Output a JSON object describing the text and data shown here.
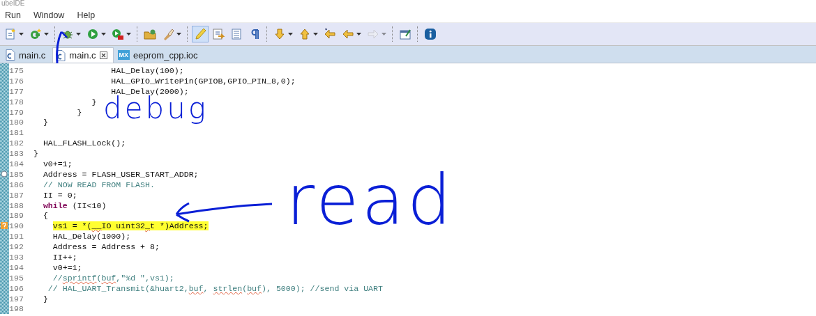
{
  "window": {
    "title": "ubeIDE"
  },
  "menu": [
    "Run",
    "Window",
    "Help"
  ],
  "toolbar": [
    {
      "kind": "new-c-file",
      "dropdown": true,
      "selected": false,
      "disabled": false
    },
    {
      "kind": "new-class",
      "dropdown": true,
      "selected": false,
      "disabled": false
    },
    {
      "kind": "separator"
    },
    {
      "kind": "debug",
      "dropdown": true,
      "selected": false,
      "disabled": false
    },
    {
      "kind": "run",
      "dropdown": true,
      "selected": false,
      "disabled": false
    },
    {
      "kind": "external-tool",
      "dropdown": true,
      "selected": false,
      "disabled": false
    },
    {
      "kind": "separator"
    },
    {
      "kind": "open-folder",
      "dropdown": false,
      "selected": false,
      "disabled": false
    },
    {
      "kind": "brush",
      "dropdown": true,
      "selected": false,
      "disabled": false
    },
    {
      "kind": "separator"
    },
    {
      "kind": "highlight",
      "dropdown": false,
      "selected": true,
      "disabled": false
    },
    {
      "kind": "toggle-word",
      "dropdown": false,
      "selected": false,
      "disabled": false
    },
    {
      "kind": "block",
      "dropdown": false,
      "selected": false,
      "disabled": false
    },
    {
      "kind": "pilcrow",
      "dropdown": false,
      "selected": false,
      "disabled": false
    },
    {
      "kind": "separator"
    },
    {
      "kind": "next-annotation",
      "dropdown": true,
      "selected": false,
      "disabled": false
    },
    {
      "kind": "prev-annotation",
      "dropdown": true,
      "selected": false,
      "disabled": false
    },
    {
      "kind": "last-edit",
      "dropdown": false,
      "selected": false,
      "disabled": false
    },
    {
      "kind": "back",
      "dropdown": true,
      "selected": false,
      "disabled": false
    },
    {
      "kind": "forward",
      "dropdown": true,
      "selected": false,
      "disabled": true
    },
    {
      "kind": "separator"
    },
    {
      "kind": "window",
      "dropdown": false,
      "selected": false,
      "disabled": false
    },
    {
      "kind": "separator"
    },
    {
      "kind": "info",
      "dropdown": false,
      "selected": false,
      "disabled": false
    }
  ],
  "tabs": [
    {
      "label": "main.c",
      "selected": false,
      "closable": false
    },
    {
      "label": "main.c",
      "selected": true,
      "closable": true
    },
    {
      "label": "eeprom_cpp.ioc",
      "badge": "MX",
      "selected": false,
      "closable": false
    }
  ],
  "editor": {
    "lines": [
      {
        "number": "175",
        "highlighted": false,
        "segments": [
          {
            "text": "                HAL_Delay(100);",
            "kind": "plain"
          }
        ]
      },
      {
        "number": "176",
        "highlighted": false,
        "segments": [
          {
            "text": "                HAL_GPIO_WritePin(GPIOB,GPIO_PIN_8,0);",
            "kind": "plain"
          }
        ]
      },
      {
        "number": "177",
        "highlighted": false,
        "segments": [
          {
            "text": "                HAL_Delay(2000);",
            "kind": "plain"
          }
        ]
      },
      {
        "number": "178",
        "highlighted": false,
        "segments": [
          {
            "text": "            }",
            "kind": "plain"
          }
        ]
      },
      {
        "number": "179",
        "highlighted": false,
        "segments": [
          {
            "text": "         }",
            "kind": "plain"
          }
        ]
      },
      {
        "number": "180",
        "highlighted": false,
        "segments": [
          {
            "text": "  }",
            "kind": "plain"
          }
        ]
      },
      {
        "number": "181"
      },
      {
        "number": "182",
        "highlighted": false,
        "segments": [
          {
            "text": "  HAL_FLASH_Lock();",
            "kind": "plain"
          }
        ]
      },
      {
        "number": "183",
        "highlighted": false,
        "segments": [
          {
            "text": "}",
            "kind": "plain"
          }
        ]
      },
      {
        "number": "184",
        "highlighted": false,
        "segments": [
          {
            "text": "  v0+=1;",
            "kind": "plain"
          }
        ]
      },
      {
        "number": "185",
        "highlighted": false,
        "marker": {
          "kind": "circle"
        },
        "segments": [
          {
            "text": "  Address = FLASH_USER_START_ADDR;",
            "kind": "plain"
          }
        ]
      },
      {
        "number": "186",
        "highlighted": false,
        "segments": [
          {
            "text": "  // NOW READ FROM FLASH.",
            "kind": "comment"
          }
        ]
      },
      {
        "number": "187",
        "highlighted": false,
        "segments": [
          {
            "text": "  II = 0;",
            "kind": "plain"
          }
        ]
      },
      {
        "number": "188",
        "highlighted": false,
        "segments": [
          {
            "text": "  while",
            "kind": "keyword"
          },
          {
            "text": " (II<10)",
            "kind": "plain"
          }
        ]
      },
      {
        "number": "189",
        "highlighted": false,
        "segments": [
          {
            "text": "  {",
            "kind": "plain"
          }
        ]
      },
      {
        "number": "190",
        "highlighted": true,
        "marker": {
          "kind": "question"
        },
        "segments": [
          {
            "text": "    vs1 = *(",
            "kind": "plain"
          },
          {
            "text": "__",
            "kind": "squiggle"
          },
          {
            "text": "IO uint32",
            "kind": "plain"
          },
          {
            "text": "_",
            "kind": "squiggle"
          },
          {
            "text": "t *)Address;",
            "kind": "plain"
          }
        ]
      },
      {
        "number": "191",
        "highlighted": false,
        "segments": [
          {
            "text": "    HAL_Delay(1000);",
            "kind": "plain"
          }
        ]
      },
      {
        "number": "192",
        "highlighted": false,
        "segments": [
          {
            "text": "    Address = Address + 8;",
            "kind": "plain"
          }
        ]
      },
      {
        "number": "193",
        "highlighted": false,
        "segments": [
          {
            "text": "    II++;",
            "kind": "plain"
          }
        ]
      },
      {
        "number": "194",
        "highlighted": false,
        "segments": [
          {
            "text": "    v0+=1;",
            "kind": "plain"
          }
        ]
      },
      {
        "number": "195",
        "highlighted": false,
        "segments": [
          {
            "text": "    //",
            "kind": "comment"
          },
          {
            "text": "sprintf",
            "kind": "comment-squiggle"
          },
          {
            "text": "(",
            "kind": "comment"
          },
          {
            "text": "buf",
            "kind": "comment-squiggle"
          },
          {
            "text": ",\"%d \",vs1);",
            "kind": "comment"
          }
        ]
      },
      {
        "number": "196",
        "highlighted": false,
        "segments": [
          {
            "text": "   // HAL_UART_Transmit(&huart2,",
            "kind": "comment"
          },
          {
            "text": "buf",
            "kind": "comment-squiggle"
          },
          {
            "text": ", ",
            "kind": "comment"
          },
          {
            "text": "strlen",
            "kind": "comment-squiggle"
          },
          {
            "text": "(",
            "kind": "comment"
          },
          {
            "text": "buf",
            "kind": "comment-squiggle"
          },
          {
            "text": "), 5000); //send via UART",
            "kind": "comment"
          }
        ]
      },
      {
        "number": "197",
        "highlighted": false,
        "segments": [
          {
            "text": "  }",
            "kind": "plain"
          }
        ]
      },
      {
        "number": "198"
      }
    ]
  },
  "annotations": [
    {
      "kind": "handwriting",
      "text": "debug"
    },
    {
      "kind": "handwriting",
      "text": "read"
    }
  ]
}
